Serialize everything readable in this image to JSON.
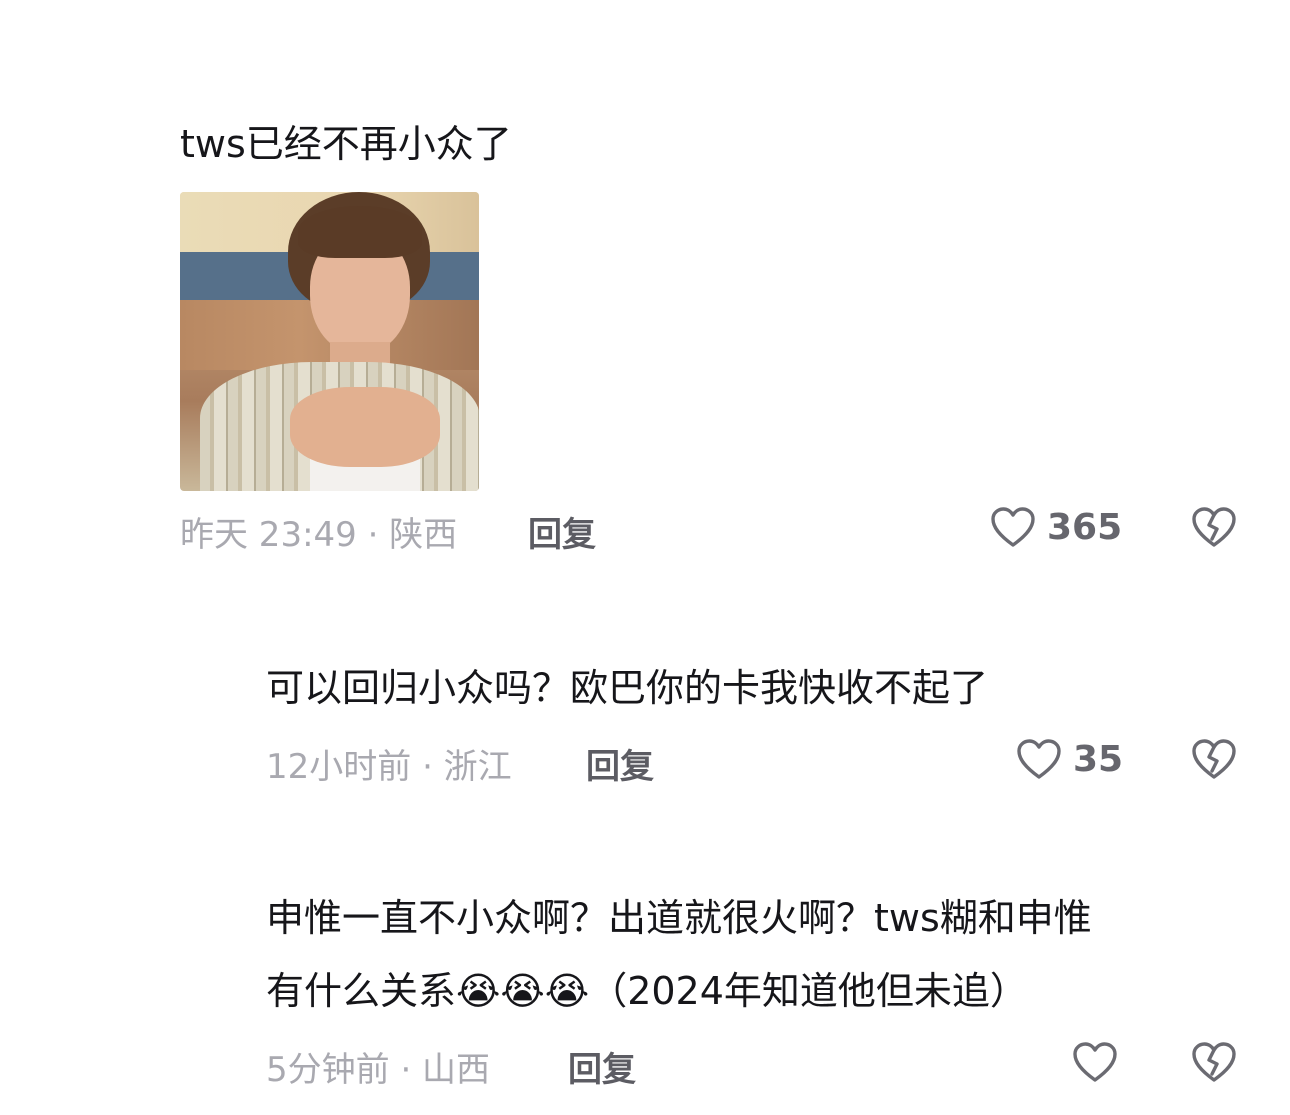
{
  "comments": [
    {
      "text": "tws已经不再小众了",
      "has_image": true,
      "time": "昨天 23:49",
      "location": "陕西",
      "meta": "昨天 23:49 · 陕西",
      "reply_label": "回复",
      "likes": "365"
    },
    {
      "text": "可以回归小众吗？欧巴你的卡我快收不起了",
      "time": "12小时前",
      "location": "浙江",
      "meta": "12小时前 · 浙江",
      "reply_label": "回复",
      "likes": "35"
    },
    {
      "text_line1": "申惟一直不小众啊？出道就很火啊？tws糊和申惟",
      "text_line2": "有什么关系😭😭😭（2024年知道他但未追）",
      "time": "5分钟前",
      "location": "山西",
      "meta": "5分钟前 · 山西",
      "reply_label": "回复",
      "likes": ""
    }
  ],
  "icons": {
    "like": "heart-outline-icon",
    "dislike": "broken-heart-icon"
  },
  "colors": {
    "text": "#16161a",
    "meta": "#a9a9b0",
    "reply": "#5c5c63",
    "icon": "#6b6b72"
  }
}
